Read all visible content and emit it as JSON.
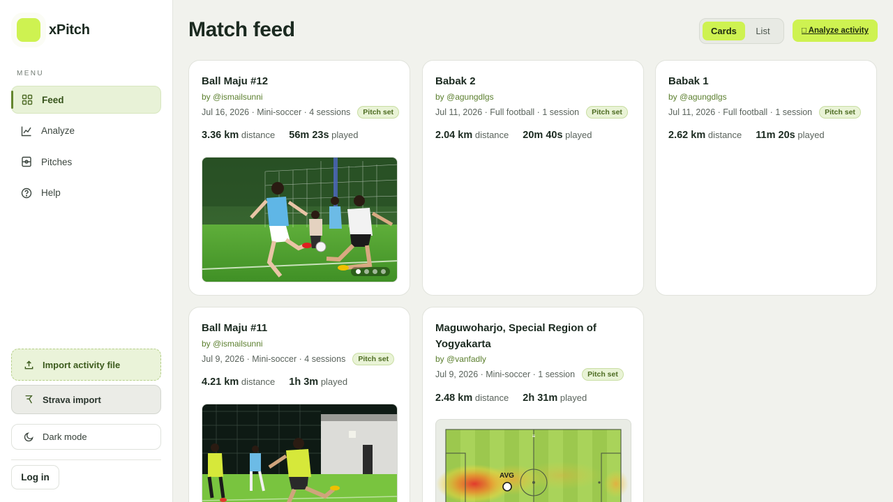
{
  "app": {
    "name": "xPitch"
  },
  "sidebar": {
    "menu_label": "MENU",
    "items": [
      {
        "label": "Feed",
        "icon": "grid-icon",
        "active": true
      },
      {
        "label": "Analyze",
        "icon": "chart-icon",
        "active": false
      },
      {
        "label": "Pitches",
        "icon": "pitch-icon",
        "active": false
      },
      {
        "label": "Help",
        "icon": "help-icon",
        "active": false
      }
    ],
    "import_label": "Import activity file",
    "strava_label": "Strava import",
    "dark_mode_label": "Dark mode",
    "login_label": "Log in"
  },
  "header": {
    "title": "Match feed",
    "view_cards": "Cards",
    "view_list": "List",
    "analyze_label": "□ Analyze activity"
  },
  "cards": [
    {
      "title": "Ball Maju #12",
      "author": "by @ismailsunni",
      "meta": "Jul 16, 2026 · Mini-soccer · 4 sessions",
      "badge": "Pitch set",
      "distance": "3.36 km",
      "distance_label": "distance",
      "played": "56m 23s",
      "played_label": "played",
      "media": "photo-players-kick",
      "slides": 4,
      "active_slide": 1
    },
    {
      "title": "Babak 2",
      "author": "by @agungdlgs",
      "meta": "Jul 11, 2026 · Full football · 1 session",
      "badge": "Pitch set",
      "distance": "2.04 km",
      "distance_label": "distance",
      "played": "20m 40s",
      "played_label": "played"
    },
    {
      "title": "Babak 1",
      "author": "by @agungdlgs",
      "meta": "Jul 11, 2026 · Full football · 1 session",
      "badge": "Pitch set",
      "distance": "2.62 km",
      "distance_label": "distance",
      "played": "11m 20s",
      "played_label": "played"
    },
    {
      "title": "Ball Maju #11",
      "author": "by @ismailsunni",
      "meta": "Jul 9, 2026 · Mini-soccer · 4 sessions",
      "badge": "Pitch set",
      "distance": "4.21 km",
      "distance_label": "distance",
      "played": "1h 3m",
      "played_label": "played",
      "media": "photo-night-match"
    },
    {
      "title": "Maguwoharjo, Special Region of Yogyakarta",
      "author": "by @vanfadly",
      "meta": "Jul 9, 2026 · Mini-soccer · 1 session",
      "badge": "Pitch set",
      "distance": "2.48 km",
      "distance_label": "distance",
      "played": "2h 31m",
      "played_label": "played",
      "media": "heatmap",
      "heatmap_marker": "AVG"
    }
  ],
  "colors": {
    "accent": "#cef251",
    "accent_dark": "#5b7f2e",
    "background": "#f1f2ed"
  }
}
